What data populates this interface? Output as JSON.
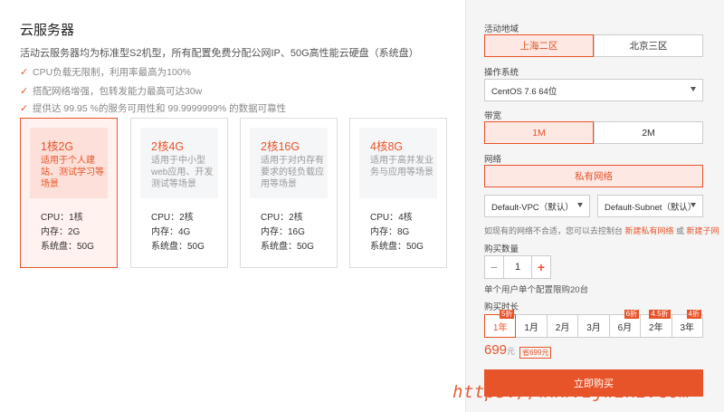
{
  "page": {
    "title": "云服务器",
    "desc": "活动云服务器均为标准型S2机型，所有配置免费分配公网IP、50G高性能云硬盘（系统盘）",
    "features": [
      "CPU负载无限制，利用率最高为100%",
      "搭配网络增强，包转发能力最高可达30w",
      "提供达 99.95 %的服务可用性和 99.9999999% 的数据可靠性"
    ]
  },
  "plans": [
    {
      "name": "1核2G",
      "note": "适用于个人建站、测试学习等场景",
      "cpu": "CPU：1核",
      "mem": "内存：2G",
      "disk": "系统盘：50G"
    },
    {
      "name": "2核4G",
      "note": "适用于中小型web应用、开发测试等场景",
      "cpu": "CPU：2核",
      "mem": "内存：4G",
      "disk": "系统盘：50G"
    },
    {
      "name": "2核16G",
      "note": "适用于对内存有要求的轻负载应用等场景",
      "cpu": "CPU：2核",
      "mem": "内存：16G",
      "disk": "系统盘：50G"
    },
    {
      "name": "4核8G",
      "note": "适用于高并发业务与应用等场景",
      "cpu": "CPU：4核",
      "mem": "内存：8G",
      "disk": "系统盘：50G"
    }
  ],
  "order": {
    "region_label": "活动地域",
    "regions": [
      "上海二区",
      "北京三区"
    ],
    "os_label": "操作系统",
    "os_value": "CentOS 7.6 64位",
    "bandwidth_label": "带宽",
    "bandwidths": [
      "1M",
      "2M"
    ],
    "network_label": "网络",
    "network_value": "私有网络",
    "vpc_value": "Default-VPC（默认）",
    "subnet_value": "Default-Subnet（默认）",
    "hint_text": "如现有的网络不合适，您可以去控制台 ",
    "hint_link1": "新建私有网络",
    "hint_or": " 或 ",
    "hint_link2": "新建子网",
    "qty_label": "购买数量",
    "qty_minus": "−",
    "qty_value": "1",
    "qty_plus": "+",
    "qty_note": "单个用户单个配置限购20台",
    "duration_label": "购买时长",
    "durations": [
      {
        "label": "1年",
        "badge": "5折"
      },
      {
        "label": "1月",
        "badge": ""
      },
      {
        "label": "2月",
        "badge": ""
      },
      {
        "label": "3月",
        "badge": ""
      },
      {
        "label": "6月",
        "badge": "6折"
      },
      {
        "label": "2年",
        "badge": "4.5折"
      },
      {
        "label": "3年",
        "badge": "4折"
      }
    ],
    "price": "699",
    "price_unit": "元",
    "save_text": "省699元",
    "buy_label": "立即购买"
  },
  "watermark": "https://www.zjwiki.com"
}
